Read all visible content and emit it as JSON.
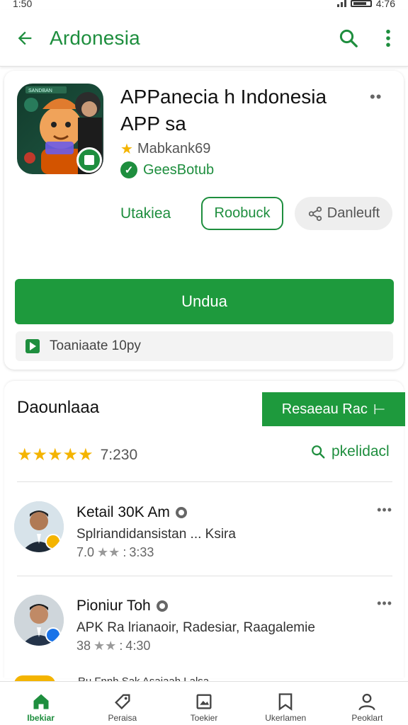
{
  "status": {
    "time": "1:50",
    "right_time": "4:76"
  },
  "appbar": {
    "title": "Ardonesia"
  },
  "app": {
    "name_line1": "APPanecia h Indonesia",
    "name_line2": "APP sa",
    "rating_text": "Mabkank69",
    "verified_text": "GeesBotub",
    "icon_label": "SANDBAN",
    "link_label": "Utakiea",
    "outline_button": "Roobuck",
    "grey_button": "Danleuft",
    "install_button": "Undua",
    "sub_bar_text": "Toaniaate 10py"
  },
  "reviews_section": {
    "title": "Daounlaaa",
    "review_button": "Resaeau Rac",
    "rating_count": "7:230",
    "see_all": "pkelidacl",
    "items": [
      {
        "name": "Ketail 30K Am",
        "text": "Splriandidansistan ... Ksira",
        "rating": "7.0",
        "time": "3:33",
        "badge_color": "#f4b400"
      },
      {
        "name": "Pioniur Toh",
        "text": "APK Ra lrianaoir, Radesiar, Raagalemie",
        "rating": "38",
        "time": "4:30",
        "badge_color": "#1a73e8"
      }
    ],
    "peek_text": "Ru Fnnh Sak Asaiaah Lalsa"
  },
  "bottom_nav": [
    {
      "label": "Ibekiar",
      "icon": "home-icon"
    },
    {
      "label": "Peraisa",
      "icon": "tag-icon"
    },
    {
      "label": "Toekier",
      "icon": "image-icon"
    },
    {
      "label": "Ukerlamen",
      "icon": "bookmark-icon"
    },
    {
      "label": "Peoklart",
      "icon": "person-icon"
    }
  ],
  "colors": {
    "accent": "#1e8e3e",
    "button": "#1e9a3d",
    "star": "#f4b400"
  }
}
